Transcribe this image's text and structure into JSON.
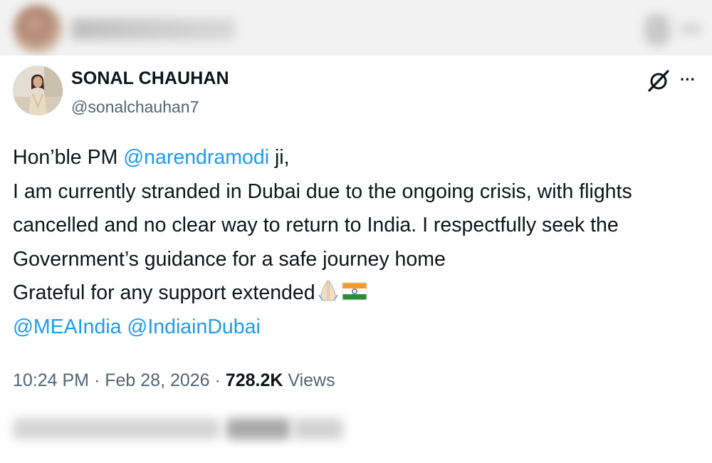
{
  "tweet": {
    "author": {
      "name": "SONAL CHAUHAN",
      "handle": "@sonalchauhan7"
    },
    "header_actions": {
      "grok_icon": "grok-icon",
      "more_icon": "more-icon",
      "more_label": "···"
    },
    "body": {
      "line1_prefix": "Hon’ble PM ",
      "line1_mention": "@narendramodi",
      "line1_suffix": " ji,",
      "line2": "I am currently stranded in Dubai due to the ongoing crisis, with flights",
      "line3": "cancelled and no clear way to return to India. I respectfully seek the",
      "line4": "Government’s guidance for a safe journey home",
      "line5": "Grateful for any support extended",
      "line5_emojis": [
        "folded-hands-emoji",
        "india-flag-emoji"
      ],
      "mention_mea": "@MEAIndia",
      "mention_space": " ",
      "mention_indiaindubai": "@IndiainDubai"
    },
    "meta": {
      "time": "10:24 PM",
      "separator": " · ",
      "date": "Feb 28, 2026",
      "views_count": "728.2K",
      "views_label": " Views"
    }
  },
  "colors": {
    "text": "#0f1419",
    "secondary": "#536471",
    "link": "#1d9bf0"
  }
}
